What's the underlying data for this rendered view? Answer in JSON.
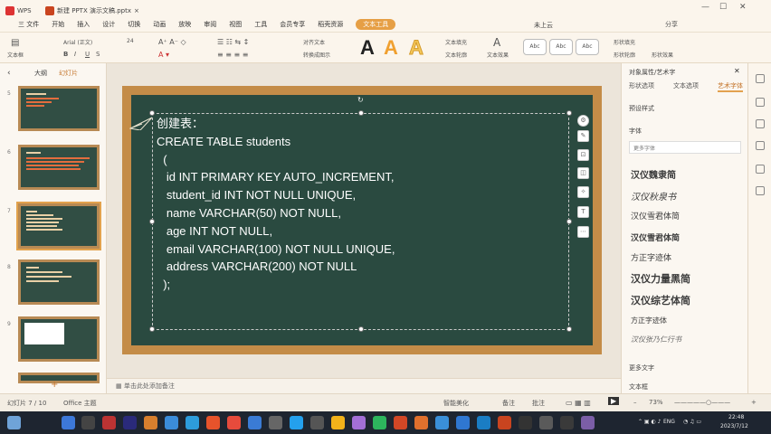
{
  "titlebar": {
    "home_tab": "WPS",
    "doc_tab": "新建 PPTX 演示文稿.pptx",
    "menu": [
      "三 文件",
      "开始",
      "插入",
      "设计",
      "切换",
      "动画",
      "放映",
      "审阅",
      "视图",
      "工具",
      "会员专享",
      "稻壳资源",
      "文本工具"
    ],
    "active_menu": "文本工具",
    "user": "未上云",
    "share": "分享"
  },
  "ribbon": {
    "text_box": "文本框",
    "font_name": "Arial (正文)",
    "font_size": "24",
    "align_text": "对齐文本",
    "convert_art": "转换成图示",
    "text_fill": "文本填充",
    "text_outline": "文本轮廓",
    "text_effect": "文本效果",
    "shape_fill": "形状填充",
    "shape_outline": "形状轮廓",
    "shape_effect": "形状效果",
    "style_labels": [
      "Abc",
      "Abc",
      "Abc"
    ]
  },
  "left_panel": {
    "tabs": [
      "大纲",
      "幻灯片"
    ],
    "slide_numbers": [
      "5",
      "6",
      "7",
      "8",
      "9"
    ],
    "add_label": "+"
  },
  "slide": {
    "code_lines": [
      "创建表：",
      "CREATE TABLE students",
      "  (",
      "   id INT PRIMARY KEY AUTO_INCREMENT,",
      "   student_id INT NOT NULL UNIQUE,",
      "   name VARCHAR(50) NOT NULL,",
      "   age INT NOT NULL,",
      "   email VARCHAR(100) NOT NULL UNIQUE,",
      "   address VARCHAR(200) NOT NULL",
      "  );"
    ]
  },
  "notes_placeholder": "单击此处添加备注",
  "right_panel": {
    "title": "对象属性/艺术字",
    "tabs": [
      "形状选项",
      "文本选项",
      "艺术字体"
    ],
    "active_tab": "艺术字体",
    "sections": [
      "预设样式",
      "字体",
      "更多字体"
    ],
    "fonts": [
      "汉仪魏隶简",
      "汉仪秋泉书",
      "汉仪雪君体简",
      "汉仪雪君体简",
      "方正字迹体",
      "汉仪力量黑简",
      "汉仪综艺体简",
      "方正字迹体",
      "汉仪张乃仁行书"
    ],
    "more_text": "更多文字",
    "text_effect": "文本框"
  },
  "statusbar": {
    "slide_info": "幻灯片 7 / 10",
    "theme": "Office 主题",
    "smart_beautify": "智能美化",
    "notes": "备注",
    "comments": "批注",
    "zoom": "73%"
  },
  "taskbar": {
    "lang": "ENG",
    "time": "22:48",
    "date": "2023/7/12"
  },
  "colors": {
    "board": "#2a4a40",
    "frame": "#c48c48",
    "accent": "#e69f45"
  }
}
